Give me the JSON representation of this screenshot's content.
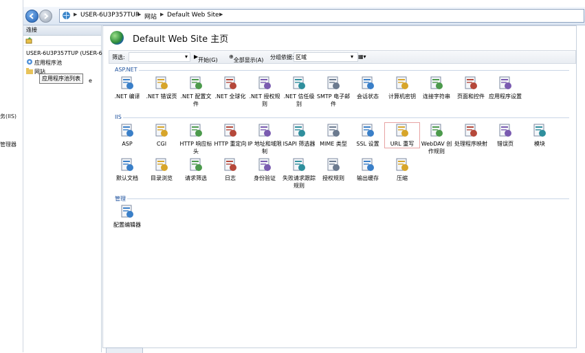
{
  "addressbar": {
    "crumbs": [
      "USER-6U3P357TUP",
      "网站",
      "Default Web Site"
    ]
  },
  "outer": {
    "cut_labels": [
      "务(IIS)",
      "管理器"
    ]
  },
  "connections": {
    "header": "连接",
    "server": "USER-6U3P357TUP (USER-6",
    "app_pools": "应用程序池",
    "sites": "网站",
    "site_cut": "e",
    "tooltip": "应用程序池列表"
  },
  "main": {
    "title": "Default Web Site 主页",
    "filter_label": "筛选:",
    "start_label": "开始(G)",
    "show_all_label": "全部显示(A)",
    "group_label": "分组依据:",
    "group_value": "区域",
    "sections": {
      "aspnet": "ASP.NET",
      "iis": "IIS",
      "mgmt": "管理"
    }
  },
  "features": {
    "aspnet": [
      {
        "label": ".NET 编译",
        "icon": "compile-icon"
      },
      {
        "label": ".NET 错误页",
        "icon": "error-page-icon"
      },
      {
        "label": ".NET 配置文件",
        "icon": "profile-icon"
      },
      {
        "label": ".NET 全球化",
        "icon": "globe-icon"
      },
      {
        "label": ".NET 授权规则",
        "icon": "authorization-icon"
      },
      {
        "label": ".NET 信任级别",
        "icon": "trust-icon"
      },
      {
        "label": "SMTP 电子邮件",
        "icon": "smtp-icon"
      },
      {
        "label": "会话状态",
        "icon": "session-icon"
      },
      {
        "label": "计算机密钥",
        "icon": "machine-key-icon"
      },
      {
        "label": "连接字符串",
        "icon": "connection-string-icon"
      },
      {
        "label": "页面和控件",
        "icon": "pages-icon"
      },
      {
        "label": "应用程序设置",
        "icon": "app-settings-icon"
      }
    ],
    "iis_row1": [
      {
        "label": "ASP",
        "icon": "asp-icon"
      },
      {
        "label": "CGI",
        "icon": "cgi-icon"
      },
      {
        "label": "HTTP 响应标头",
        "icon": "http-headers-icon"
      },
      {
        "label": "HTTP 重定向",
        "icon": "redirect-icon"
      },
      {
        "label": "IP 地址和域限制",
        "icon": "ip-restrict-icon"
      },
      {
        "label": "ISAPI 筛选器",
        "icon": "isapi-icon"
      },
      {
        "label": "MIME 类型",
        "icon": "mime-icon"
      },
      {
        "label": "SSL 设置",
        "icon": "ssl-lock-icon"
      },
      {
        "label": "URL 重写",
        "icon": "url-rewrite-icon"
      },
      {
        "label": "WebDAV 创作规则",
        "icon": "webdav-icon"
      },
      {
        "label": "处理程序映射",
        "icon": "handler-icon"
      },
      {
        "label": "错误页",
        "icon": "error-icon"
      },
      {
        "label": "模块",
        "icon": "modules-icon"
      }
    ],
    "iis_row2": [
      {
        "label": "默认文档",
        "icon": "default-doc-icon"
      },
      {
        "label": "目录浏览",
        "icon": "dir-browse-icon"
      },
      {
        "label": "请求筛选",
        "icon": "request-filter-icon"
      },
      {
        "label": "日志",
        "icon": "logging-icon"
      },
      {
        "label": "身份验证",
        "icon": "auth-icon"
      },
      {
        "label": "失败请求跟踪规则",
        "icon": "failed-request-icon"
      },
      {
        "label": "授权规则",
        "icon": "authz-rules-icon"
      },
      {
        "label": "输出缓存",
        "icon": "output-cache-icon"
      },
      {
        "label": "压缩",
        "icon": "compression-icon"
      }
    ],
    "mgmt": [
      {
        "label": "配置编辑器",
        "icon": "config-editor-icon"
      }
    ]
  },
  "colors": {
    "accent": "#1b4f9c",
    "selected_outline": "#e7a2a2"
  }
}
